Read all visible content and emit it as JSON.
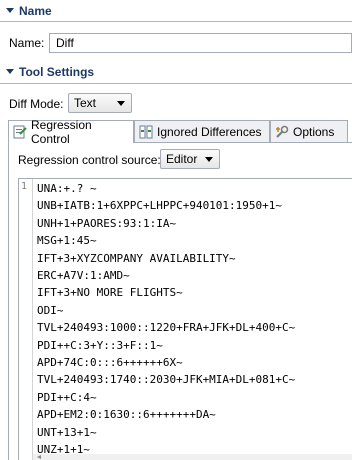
{
  "name_section": {
    "title": "Name",
    "name_label": "Name:",
    "name_value": "Diff"
  },
  "tool_settings": {
    "title": "Tool Settings",
    "diff_mode_label": "Diff Mode:",
    "diff_mode_value": "Text"
  },
  "tabs": [
    {
      "label": "Regression Control",
      "icon": "regression-control-icon",
      "active": true
    },
    {
      "label": "Ignored Differences",
      "icon": "ignored-differences-icon",
      "active": false
    },
    {
      "label": "Options",
      "icon": "options-icon",
      "active": false
    }
  ],
  "regression": {
    "source_label": "Regression control source:",
    "source_value": "Editor"
  },
  "editor": {
    "first_line_number": "1",
    "lines": [
      "UNA:+.? ~",
      "UNB+IATB:1+6XPPC+LHPPC+940101:1950+1~",
      "UNH+1+PAORES:93:1:IA~",
      "MSG+1:45~",
      "IFT+3+XYZCOMPANY AVAILABILITY~",
      "ERC+A7V:1:AMD~",
      "IFT+3+NO MORE FLIGHTS~",
      "ODI~",
      "TVL+240493:1000::1220+FRA+JFK+DL+400+C~",
      "PDI++C:3+Y::3+F::1~",
      "APD+74C:0:::6++++++6X~",
      "TVL+240493:1740::2030+JFK+MIA+DL+081+C~",
      "PDI++C:4~",
      "APD+EM2:0:1630::6+++++++DA~",
      "UNT+13+1~",
      "UNZ+1+1~"
    ]
  },
  "colors": {
    "section_title": "#1d3a63",
    "border": "#a5acb5"
  }
}
